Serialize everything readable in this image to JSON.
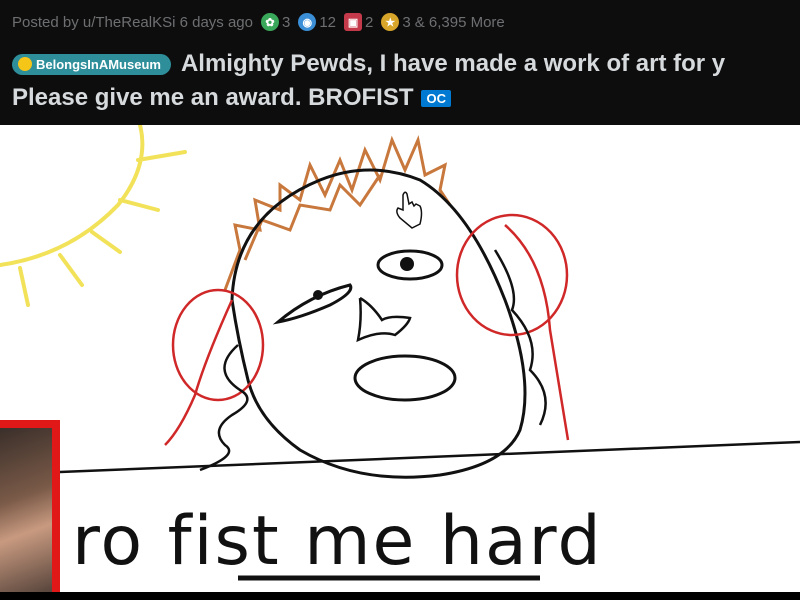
{
  "post": {
    "meta_text": "Posted by u/TheRealKSi 6 days ago",
    "awards": [
      {
        "icon": "green-award-icon",
        "count": "3",
        "color": "#3aa85a"
      },
      {
        "icon": "blue-award-icon",
        "count": "12",
        "color": "#3a8fd6"
      },
      {
        "icon": "red-award-icon",
        "count": "2",
        "color": "#c53a4a"
      },
      {
        "icon": "gold-award-icon",
        "count": "3",
        "color": "#d6a52a"
      }
    ],
    "more_awards": "& 6,395 More",
    "flair": "BelongsInAMuseum",
    "title_line1": "Almighty Pewds, I have made a work of art for y",
    "title_line2": "Please give me an award. BROFIST",
    "oc_badge": "OC"
  },
  "drawing": {
    "handwritten_text": "ro fist me hard"
  },
  "colors": {
    "header_bg": "#0d0d0e",
    "flair_bg": "#2e8f9b",
    "oc_bg": "#0079d3",
    "facecam_border": "#e01818"
  }
}
